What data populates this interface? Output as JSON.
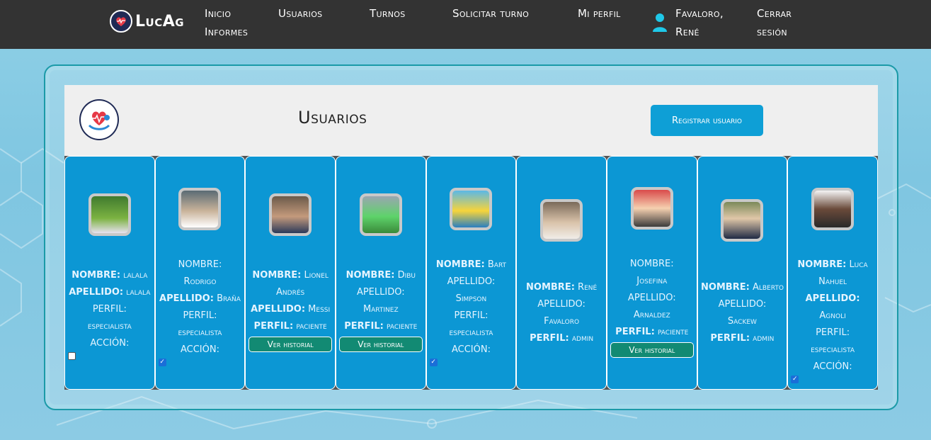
{
  "nav": {
    "brand": "LucAg",
    "links": [
      "Inicio",
      "Informes",
      "Usuarios",
      "Turnos",
      "Solicitar turno",
      "Mi perfil"
    ],
    "user_first_line": "Favaloro,",
    "user_second_line": "René",
    "logout_line1": "Cerrar",
    "logout_line2": "sesión"
  },
  "panel": {
    "title": "Usuarios",
    "register_label": "Registrar usuario"
  },
  "labels": {
    "nombre": "NOMBRE:",
    "apellido": "APELLIDO:",
    "perfil": "PERFIL:",
    "accion": "ACCIÓN:",
    "historial": "Ver historial"
  },
  "users": [
    {
      "nombre": "lalala",
      "apellido": "lalala",
      "perfil": "especialista",
      "accion": "unchecked"
    },
    {
      "nombre": "Rodrigo",
      "apellido": "Braña",
      "perfil": "especialista",
      "accion": "checked"
    },
    {
      "nombre": "Lionel Andrés",
      "apellido": "Messi",
      "perfil": "paciente",
      "accion": "historial"
    },
    {
      "nombre": "Dibu",
      "apellido": "Martinez",
      "perfil": "paciente",
      "accion": "historial"
    },
    {
      "nombre": "Bart",
      "apellido": "Simpson",
      "perfil": "especialista",
      "accion": "checked"
    },
    {
      "nombre": "René",
      "apellido": "Favaloro",
      "perfil": "admin",
      "accion": "none"
    },
    {
      "nombre": "Josefina",
      "apellido": "Arnaldez",
      "perfil": "paciente",
      "accion": "historial"
    },
    {
      "nombre": "Alberto",
      "apellido": "Sackew",
      "perfil": "admin",
      "accion": "none"
    },
    {
      "nombre": "Luca Nahuel",
      "apellido": "Agnoli",
      "perfil": "especialista",
      "accion": "checked"
    }
  ],
  "colors": {
    "navbar": "#333333",
    "card": "#0c97d4",
    "accent": "#0e9fd6",
    "historial_button": "#128a73",
    "user_icon": "#1fc8e8"
  },
  "icons": {
    "brand": "heart-hand-logo-icon",
    "user": "user-icon"
  }
}
